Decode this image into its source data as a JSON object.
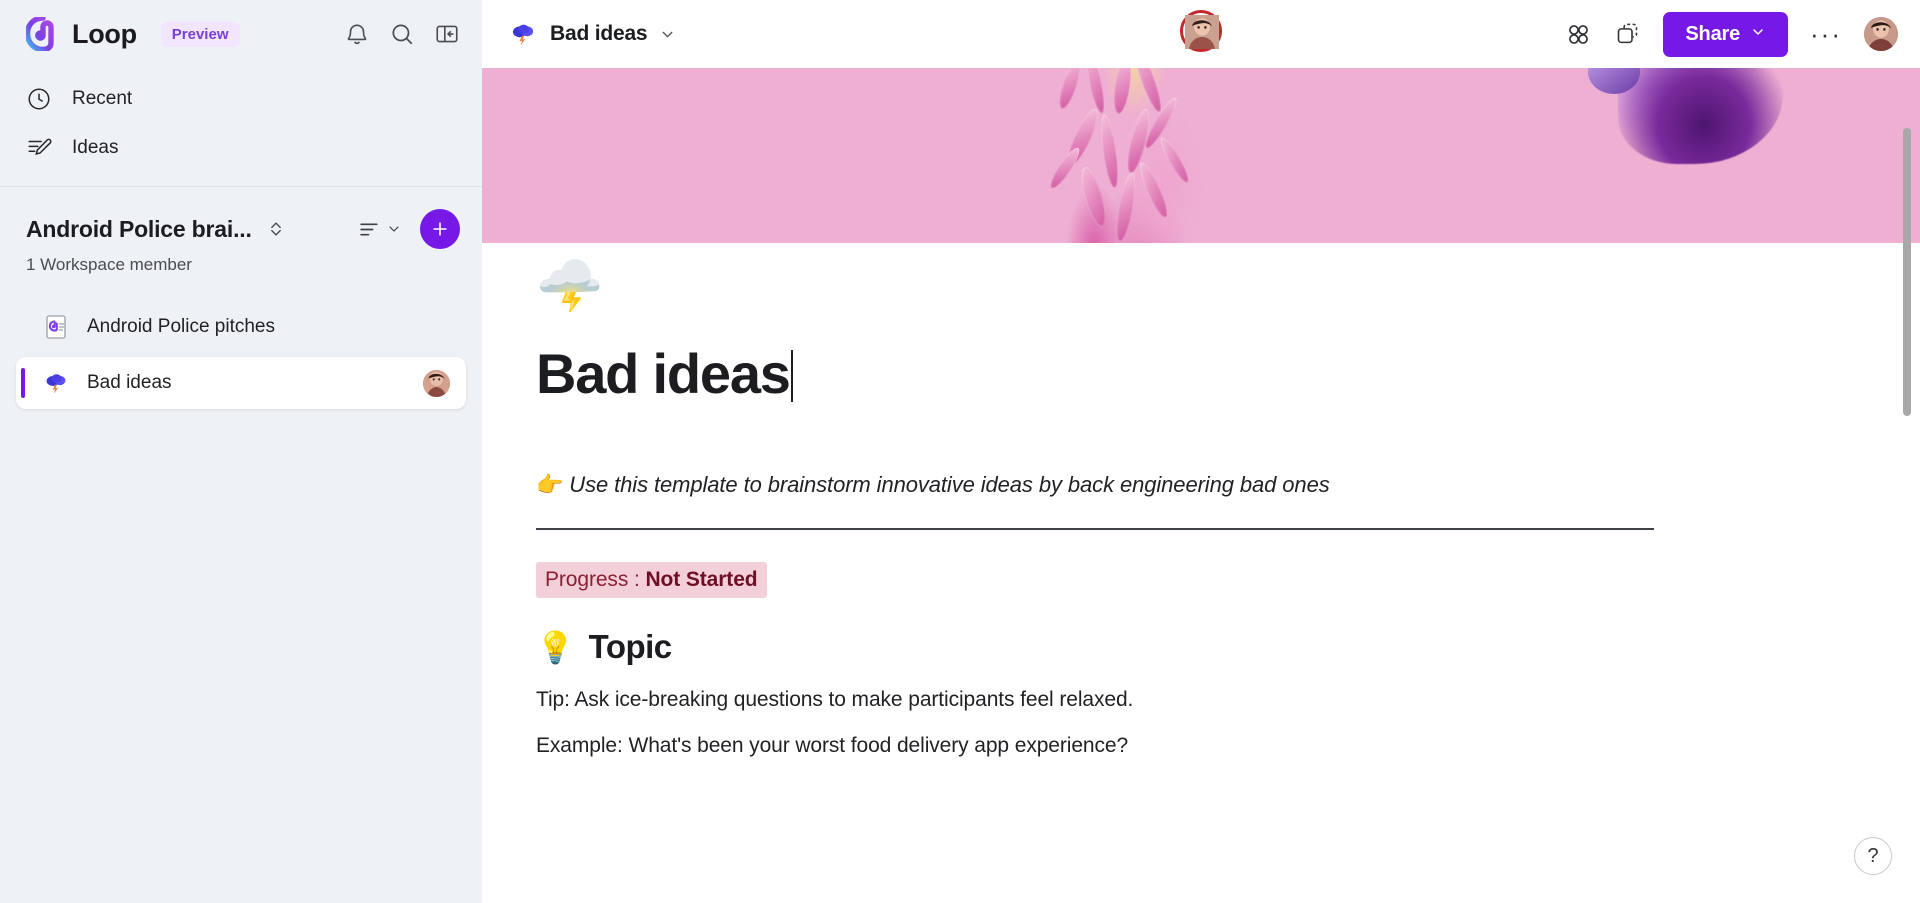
{
  "app": {
    "name": "Loop",
    "badge": "Preview",
    "logo_icon": "loop-logo-icon",
    "accent_color": "#7719e6"
  },
  "sidebar": {
    "top_icons": [
      {
        "name": "notifications-icon",
        "glyph": "bell"
      },
      {
        "name": "search-icon",
        "glyph": "search"
      },
      {
        "name": "collapse-sidebar-icon",
        "glyph": "panel-collapse"
      }
    ],
    "nav": [
      {
        "label": "Recent",
        "icon": "clock-icon"
      },
      {
        "label": "Ideas",
        "icon": "pencil-lines-icon"
      }
    ],
    "workspace": {
      "title": "Android Police brai...",
      "members": "1 Workspace member",
      "switcher_icon": "chevron-up-down-icon",
      "sort_icon": "sort-lines-icon",
      "add_icon": "plus-icon"
    },
    "pages": [
      {
        "label": "Android Police pitches",
        "icon": "loop-page-icon",
        "selected": false,
        "has_avatar": false
      },
      {
        "label": "Bad ideas",
        "icon": "cloud-lightning-emoji",
        "emoji": "🌩️",
        "selected": true,
        "has_avatar": true
      }
    ]
  },
  "topbar": {
    "doc_name": "Bad ideas",
    "doc_emoji": "🌩️",
    "doc_menu_icon": "chevron-down-icon",
    "presence_avatar": "collaborator-avatar",
    "presence_ring_color": "#c2282e",
    "right_icons": [
      {
        "name": "apps-grid-icon"
      },
      {
        "name": "copy-component-icon"
      }
    ],
    "share_label": "Share",
    "share_chevron_icon": "chevron-down-icon",
    "overflow_label": "···",
    "account_avatar": "account-avatar"
  },
  "document": {
    "cover_image": "pink-abstract-cover",
    "emoji": "🌩️",
    "title": "Bad ideas",
    "subtitle_emoji": "👉",
    "subtitle": "Use this template to brainstorm innovative ideas by back engineering bad ones",
    "progress_label": "Progress : ",
    "progress_value": "Not Started",
    "progress_bg": "#f3d0d9",
    "progress_fg": "#6f0f25",
    "section_emoji": "💡",
    "section_title": "Topic",
    "paragraphs": [
      "Tip: Ask ice-breaking questions to make participants feel relaxed.",
      "Example: What's been your worst food delivery app experience?"
    ]
  },
  "help": {
    "label": "?"
  }
}
